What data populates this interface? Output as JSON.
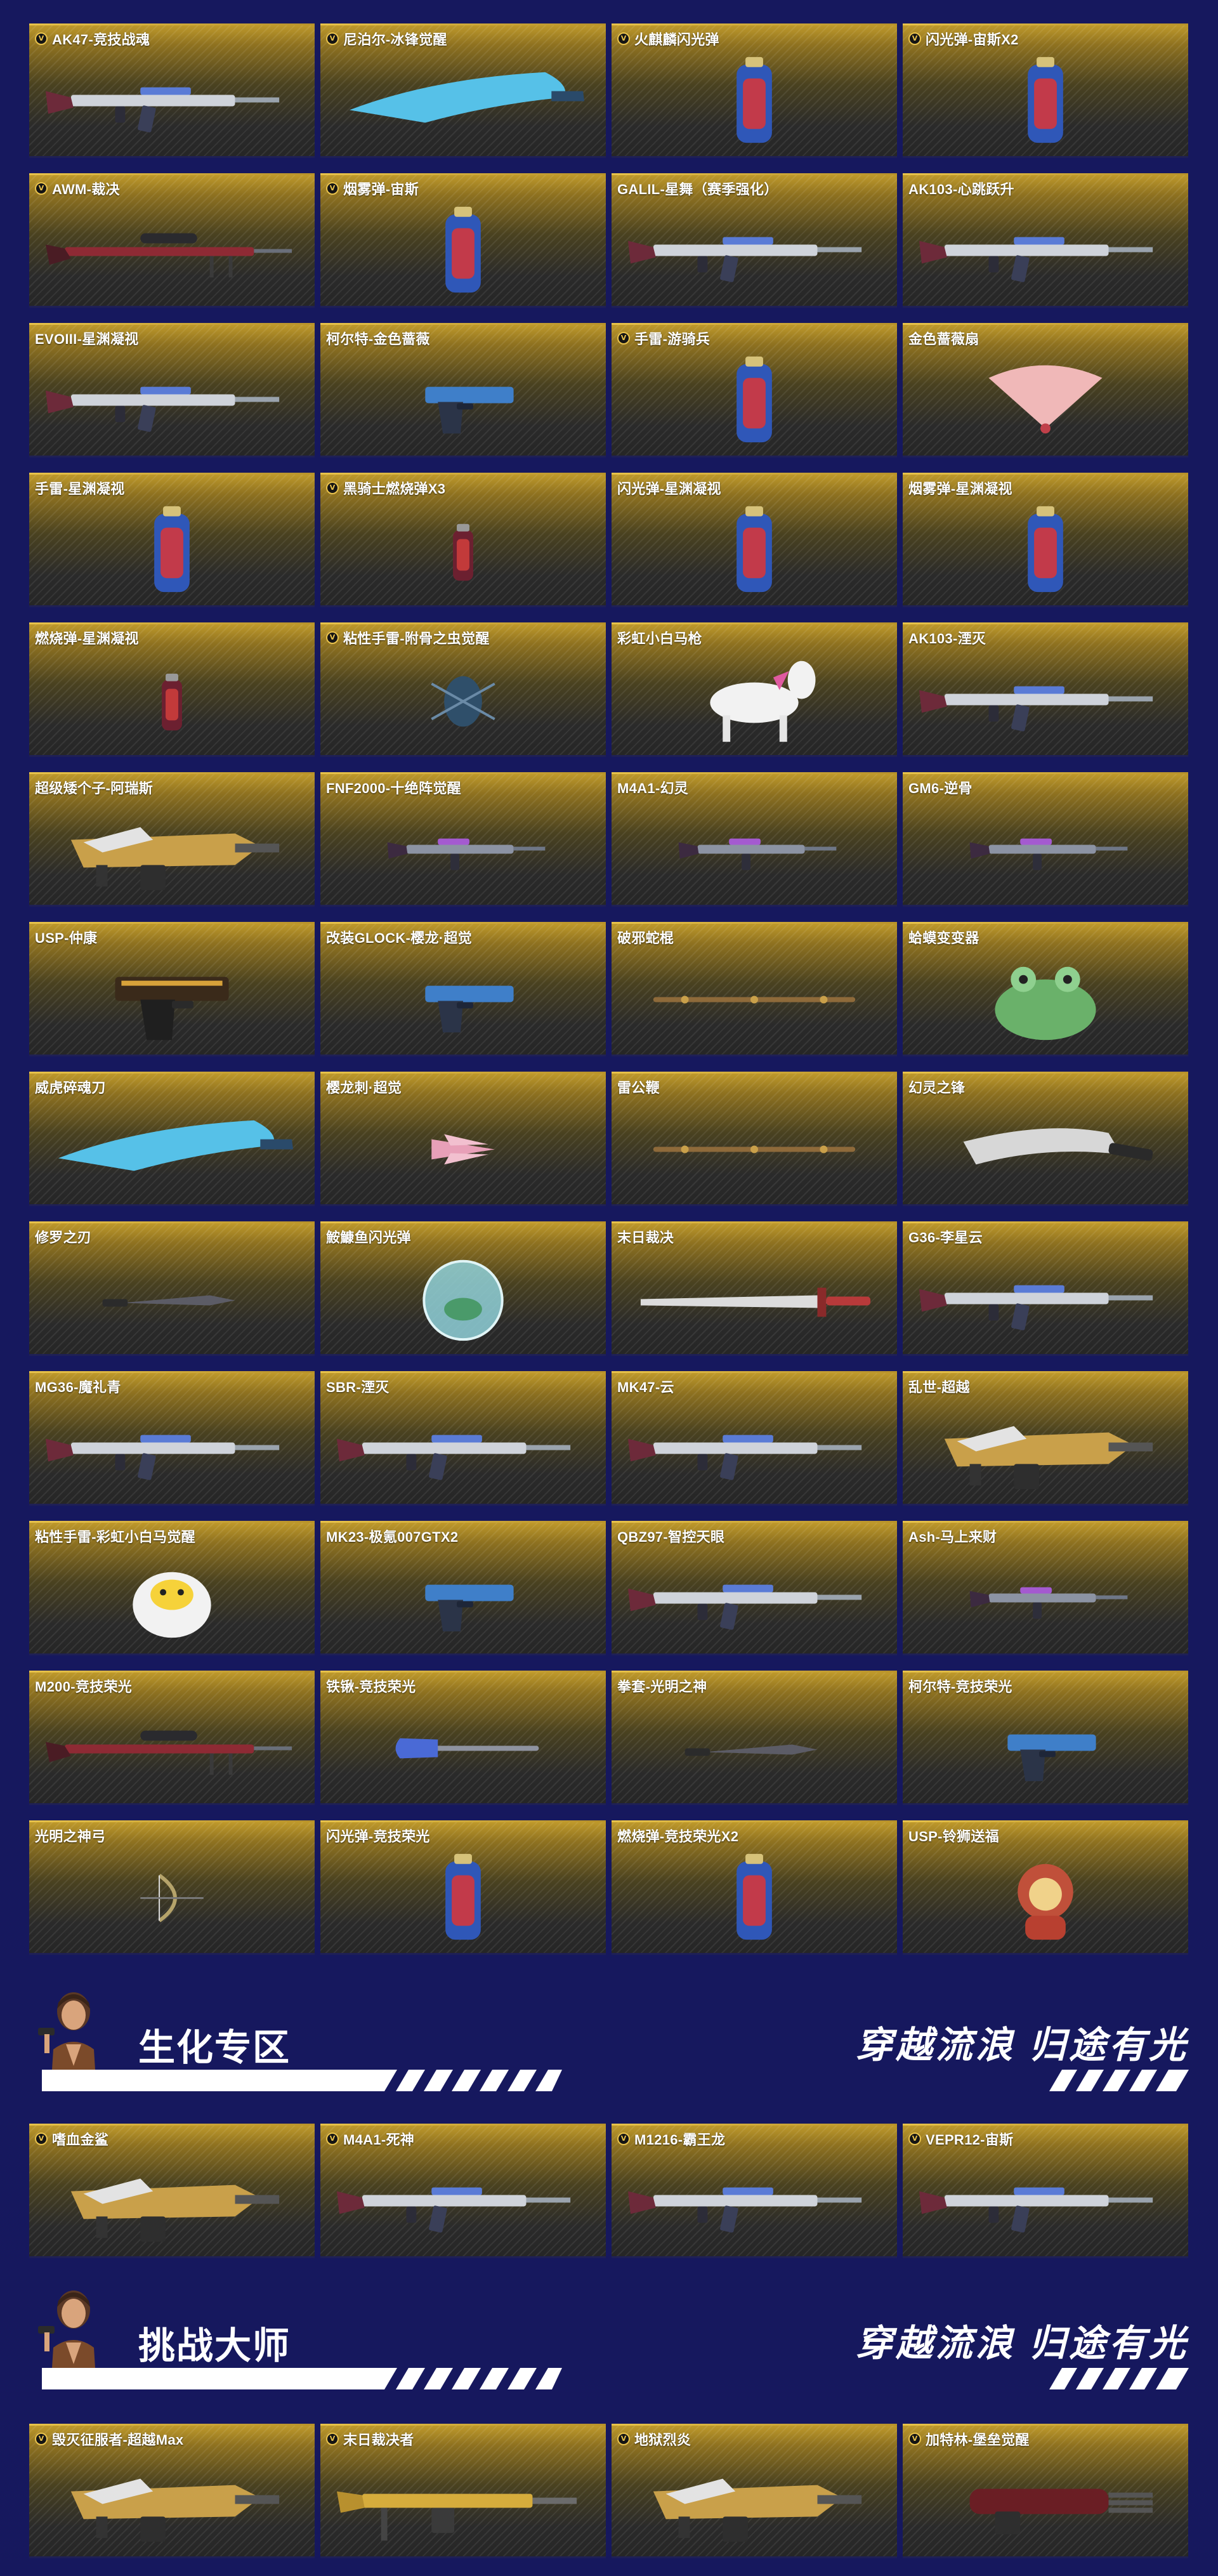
{
  "accent_gold": "#e9c24c",
  "page_bg": "#16185e",
  "main_items": [
    {
      "name": "AK47-竞技战魂",
      "vip": true,
      "icon": "rifle"
    },
    {
      "name": "尼泊尔-冰锋觉醒",
      "vip": true,
      "icon": "blade"
    },
    {
      "name": "火麒麟闪光弹",
      "vip": true,
      "icon": "grenade"
    },
    {
      "name": "闪光弹-宙斯X2",
      "vip": true,
      "icon": "grenade"
    },
    {
      "name": "AWM-裁决",
      "vip": true,
      "icon": "sniper"
    },
    {
      "name": "烟雾弹-宙斯",
      "vip": true,
      "icon": "grenade"
    },
    {
      "name": "GALIL-星舞（赛季强化）",
      "vip": false,
      "icon": "rifle"
    },
    {
      "name": "AK103-心跳跃升",
      "vip": false,
      "icon": "rifle"
    },
    {
      "name": "EVOIII-星渊凝视",
      "vip": false,
      "icon": "rifle"
    },
    {
      "name": "柯尔特-金色蔷薇",
      "vip": false,
      "icon": "pistol"
    },
    {
      "name": "手雷-游骑兵",
      "vip": true,
      "icon": "grenade"
    },
    {
      "name": "金色蔷薇扇",
      "vip": false,
      "icon": "fan"
    },
    {
      "name": "手雷-星渊凝视",
      "vip": false,
      "icon": "grenade"
    },
    {
      "name": "黑骑士燃烧弹X3",
      "vip": true,
      "icon": "grenade-small"
    },
    {
      "name": "闪光弹-星渊凝视",
      "vip": false,
      "icon": "grenade"
    },
    {
      "name": "烟雾弹-星渊凝视",
      "vip": false,
      "icon": "grenade"
    },
    {
      "name": "燃烧弹-星渊凝视",
      "vip": false,
      "icon": "grenade-small"
    },
    {
      "name": "粘性手雷-附骨之虫觉醒",
      "vip": true,
      "icon": "bug"
    },
    {
      "name": "彩虹小白马枪",
      "vip": false,
      "icon": "horse"
    },
    {
      "name": "AK103-湮灭",
      "vip": false,
      "icon": "rifle"
    },
    {
      "name": "超级矮个子-阿瑞斯",
      "vip": false,
      "icon": "heavy"
    },
    {
      "name": "FNF2000-十绝阵觉醒",
      "vip": false,
      "icon": "rifle-small"
    },
    {
      "name": "M4A1-幻灵",
      "vip": false,
      "icon": "rifle-small"
    },
    {
      "name": "GM6-逆骨",
      "vip": false,
      "icon": "rifle-small"
    },
    {
      "name": "USP-仲康",
      "vip": false,
      "icon": "pistol-big"
    },
    {
      "name": "改装GLOCK-樱龙·超觉",
      "vip": false,
      "icon": "pistol"
    },
    {
      "name": "破邪蛇棍",
      "vip": false,
      "icon": "staff"
    },
    {
      "name": "蛤蟆变变器",
      "vip": false,
      "icon": "frog"
    },
    {
      "name": "威虎碎魂刀",
      "vip": false,
      "icon": "blade"
    },
    {
      "name": "樱龙刺·超觉",
      "vip": false,
      "icon": "claw"
    },
    {
      "name": "雷公鞭",
      "vip": false,
      "icon": "staff"
    },
    {
      "name": "幻灵之锋",
      "vip": false,
      "icon": "machete"
    },
    {
      "name": "修罗之刃",
      "vip": false,
      "icon": "knife"
    },
    {
      "name": "鮟鱇鱼闪光弹",
      "vip": false,
      "icon": "orb"
    },
    {
      "name": "末日裁决",
      "vip": false,
      "icon": "sword"
    },
    {
      "name": "G36-李星云",
      "vip": false,
      "icon": "rifle"
    },
    {
      "name": "MG36-魔礼青",
      "vip": false,
      "icon": "rifle"
    },
    {
      "name": "SBR-湮灭",
      "vip": false,
      "icon": "rifle"
    },
    {
      "name": "MK47-云",
      "vip": false,
      "icon": "rifle"
    },
    {
      "name": "乱世-超越",
      "vip": false,
      "icon": "heavy"
    },
    {
      "name": "粘性手雷-彩虹小白马觉醒",
      "vip": false,
      "icon": "chick"
    },
    {
      "name": "MK23-极氪007GTX2",
      "vip": false,
      "icon": "pistol"
    },
    {
      "name": "QBZ97-智控天眼",
      "vip": false,
      "icon": "rifle"
    },
    {
      "name": "Ash-马上来财",
      "vip": false,
      "icon": "rifle-small"
    },
    {
      "name": "M200-竞技荣光",
      "vip": false,
      "icon": "sniper"
    },
    {
      "name": "铁锹-竞技荣光",
      "vip": false,
      "icon": "shovel"
    },
    {
      "name": "拳套-光明之神",
      "vip": false,
      "icon": "knife"
    },
    {
      "name": "柯尔特-竞技荣光",
      "vip": false,
      "icon": "pistol"
    },
    {
      "name": "光明之神弓",
      "vip": false,
      "icon": "bow"
    },
    {
      "name": "闪光弹-竞技荣光",
      "vip": false,
      "icon": "grenade"
    },
    {
      "name": "燃烧弹-竞技荣光X2",
      "vip": false,
      "icon": "grenade"
    },
    {
      "name": "USP-铃狮送福",
      "vip": false,
      "icon": "lion"
    }
  ],
  "sections": {
    "bio": {
      "title": "生化专区",
      "slogan": "穿越流浪 归途有光"
    },
    "challenge": {
      "title": "挑战大师",
      "slogan": "穿越流浪 归途有光"
    }
  },
  "bio_items": [
    {
      "name": "嗜血金鲨",
      "vip": true,
      "icon": "heavy"
    },
    {
      "name": "M4A1-死神",
      "vip": true,
      "icon": "rifle"
    },
    {
      "name": "M1216-霸王龙",
      "vip": true,
      "icon": "rifle"
    },
    {
      "name": "VEPR12-宙斯",
      "vip": true,
      "icon": "rifle"
    }
  ],
  "challenge_items": [
    {
      "name": "毁灭征服者-超越Max",
      "vip": true,
      "icon": "heavy"
    },
    {
      "name": "末日裁决者",
      "vip": true,
      "icon": "mg"
    },
    {
      "name": "地狱烈炎",
      "vip": true,
      "icon": "heavy"
    },
    {
      "name": "加特林-堡垒觉醒",
      "vip": true,
      "icon": "minigun"
    }
  ]
}
